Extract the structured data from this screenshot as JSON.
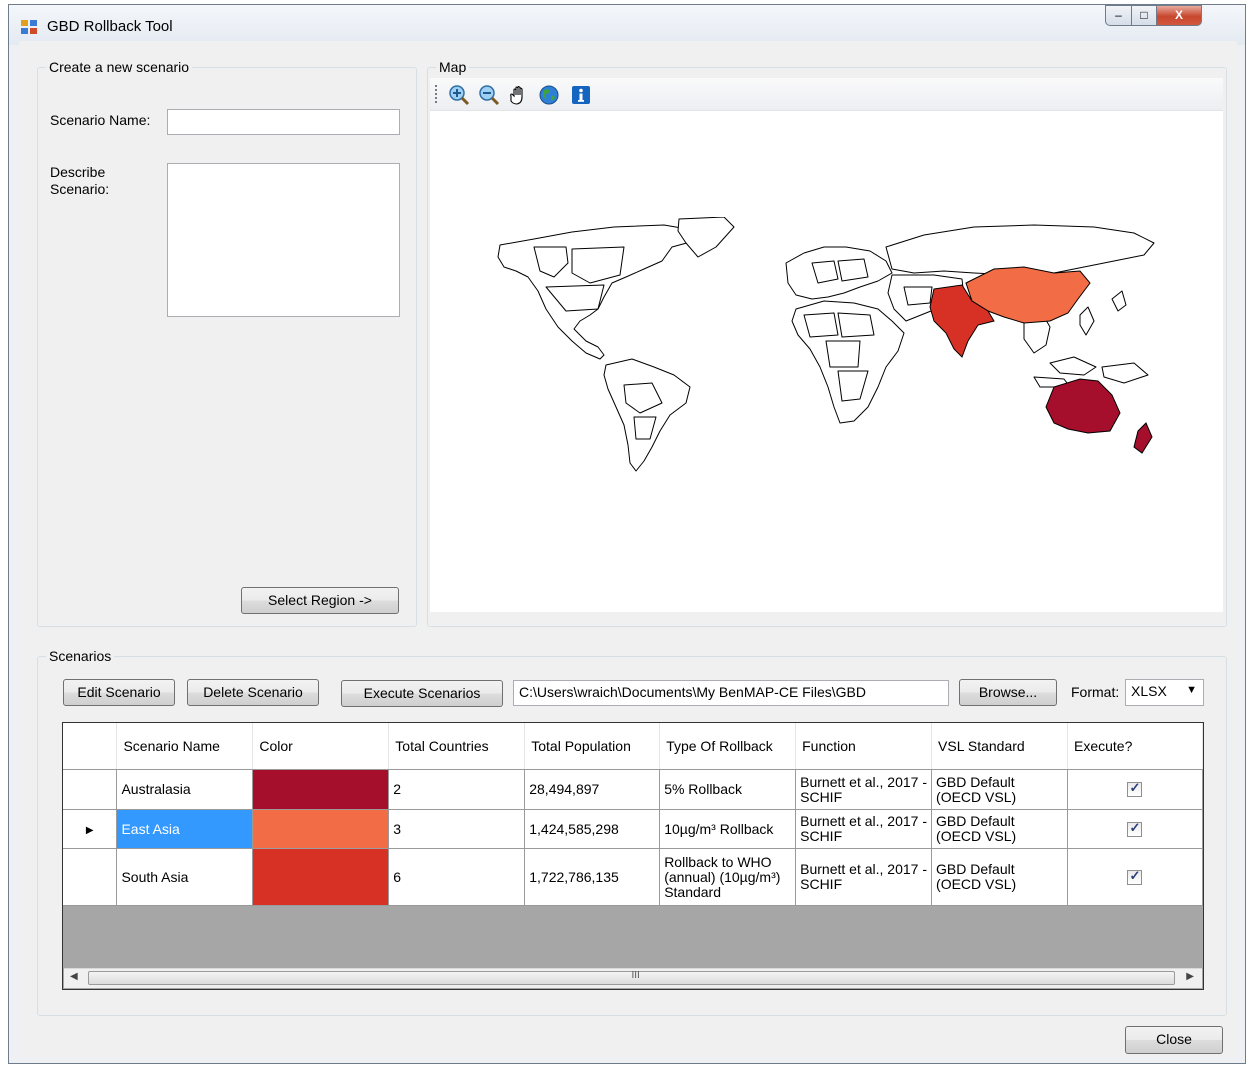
{
  "window": {
    "title": "GBD Rollback Tool",
    "min_glyph": "–",
    "max_glyph": "□",
    "close_glyph": "X"
  },
  "scenario_form": {
    "legend": "Create a new scenario",
    "name_label": "Scenario Name:",
    "name_value": "",
    "describe_label_1": "Describe",
    "describe_label_2": "Scenario:",
    "describe_value": "",
    "select_region_button": "Select Region ->"
  },
  "map": {
    "legend": "Map",
    "tools": [
      "zoom-in-icon",
      "zoom-out-icon",
      "pan-hand-icon",
      "full-extent-globe-icon",
      "info-icon"
    ],
    "region_colors": {
      "Australasia": "#a50f2c",
      "East Asia": "#f26c45",
      "South Asia": "#d73125"
    }
  },
  "scenarios": {
    "legend": "Scenarios",
    "edit_button": "Edit Scenario",
    "delete_button": "Delete Scenario",
    "execute_button": "Execute Scenarios",
    "output_path": "C:\\Users\\wraich\\Documents\\My BenMAP-CE Files\\GBD",
    "browse_button": "Browse...",
    "format_label": "Format:",
    "format_value": "XLSX",
    "columns": {
      "name": "Scenario Name",
      "color": "Color",
      "countries": "Total Countries",
      "population": "Total Population",
      "rollback": "Type Of Rollback",
      "function": "Function",
      "vsl": "VSL Standard",
      "execute": "Execute?"
    },
    "rows": [
      {
        "name": "Australasia",
        "color": "#a50f2c",
        "countries": "2",
        "population": "28,494,897",
        "rollback": "5% Rollback",
        "function": "Burnett et al., 2017 - SCHIF",
        "vsl": "GBD Default (OECD VSL)",
        "execute": true,
        "selected": false
      },
      {
        "name": "East Asia",
        "color": "#f26c45",
        "countries": "3",
        "population": "1,424,585,298",
        "rollback": "10µg/m³ Rollback",
        "function": "Burnett et al., 2017 - SCHIF",
        "vsl": "GBD Default (OECD VSL)",
        "execute": true,
        "selected": true
      },
      {
        "name": "South Asia",
        "color": "#d73125",
        "countries": "6",
        "population": "1,722,786,135",
        "rollback": "Rollback to WHO (annual) (10µg/m³) Standard",
        "function": "Burnett et al., 2017 - SCHIF",
        "vsl": "GBD Default (OECD VSL)",
        "execute": true,
        "selected": false
      }
    ],
    "scroll_grip": "III"
  },
  "close_button": "Close"
}
